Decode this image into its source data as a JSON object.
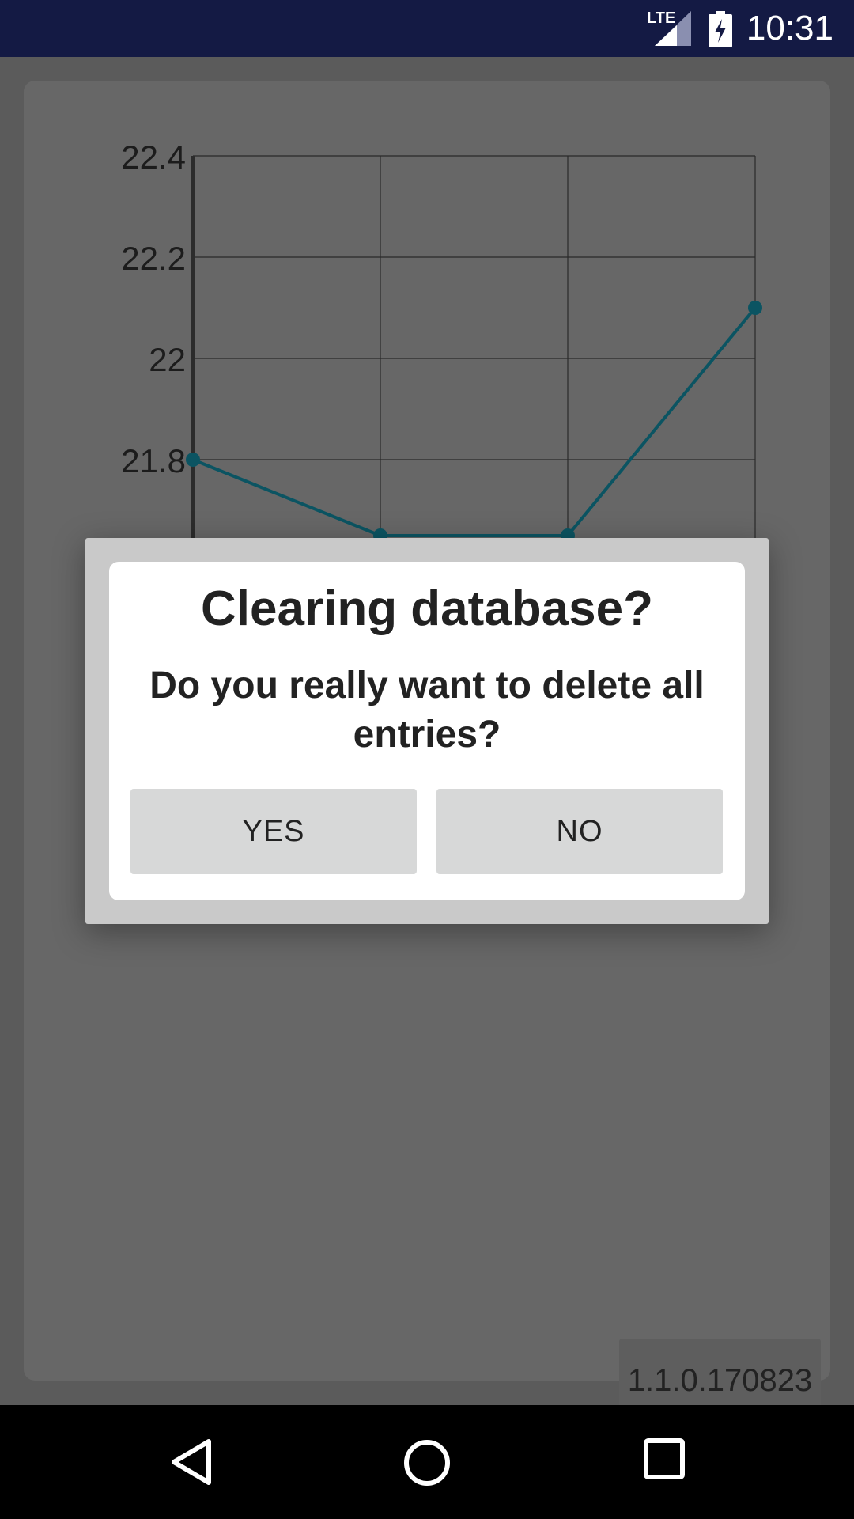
{
  "status_bar": {
    "time": "10:31",
    "network_label": "LTE",
    "icons": [
      "signal-icon",
      "battery-charging-icon"
    ]
  },
  "chart_data": {
    "type": "line",
    "y_ticks": [
      "22.4",
      "22.2",
      "22",
      "21.8"
    ],
    "ylim": [
      21.65,
      22.4
    ],
    "x": [
      0,
      1,
      2,
      3
    ],
    "xlim": [
      0,
      3
    ],
    "series": [
      {
        "values": [
          21.8,
          21.65,
          21.65,
          22.1
        ],
        "color": "#0b5462"
      }
    ],
    "grid": true
  },
  "version": "1.1.0.170823",
  "dialog": {
    "title": "Clearing database?",
    "message": "Do you really want to delete all entries?",
    "yes_label": "YES",
    "no_label": "NO"
  },
  "nav_bar": {
    "icons": [
      "back-icon",
      "home-icon",
      "recents-icon"
    ]
  },
  "colors": {
    "status_bar": "#141a44",
    "line": "#0b5462",
    "scrim": "#5b5b5b",
    "button": "#d7d8d8"
  }
}
